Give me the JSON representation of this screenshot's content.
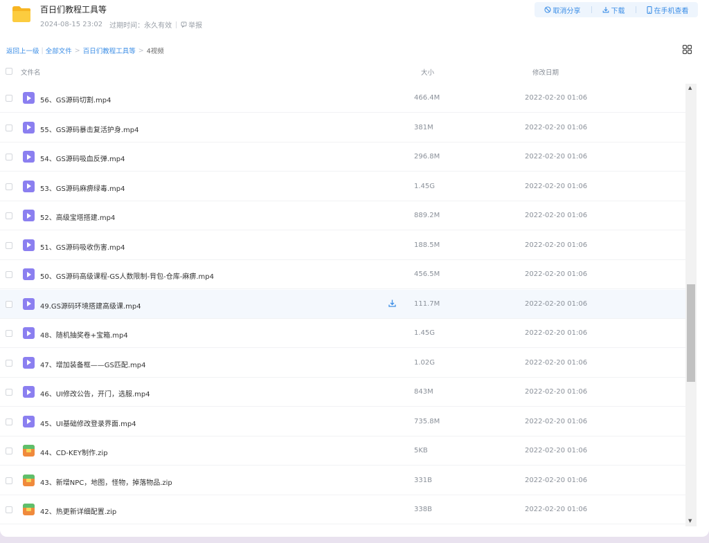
{
  "header": {
    "title": "百日们教程工具等",
    "date": "2024-08-15 23:02",
    "expire_label": "过期时间：永久有效",
    "report_label": "举报"
  },
  "actions": {
    "cancel_share": "取消分享",
    "download": "下载",
    "view_on_phone": "在手机查看"
  },
  "breadcrumb": {
    "back": "返回上一级",
    "all_files": "全部文件",
    "folder": "百日们教程工具等",
    "current": "4视频"
  },
  "columns": {
    "name": "文件名",
    "size": "大小",
    "modified": "修改日期"
  },
  "files": [
    {
      "name": "56、GS源码切割.mp4",
      "size": "466.4M",
      "date": "2022-02-20 01:06",
      "type": "video"
    },
    {
      "name": "55、GS源码暴击复活护身.mp4",
      "size": "381M",
      "date": "2022-02-20 01:06",
      "type": "video"
    },
    {
      "name": "54、GS源码吸血反弹.mp4",
      "size": "296.8M",
      "date": "2022-02-20 01:06",
      "type": "video"
    },
    {
      "name": "53、GS源码麻痹绿毒.mp4",
      "size": "1.45G",
      "date": "2022-02-20 01:06",
      "type": "video"
    },
    {
      "name": "52、高级宝塔搭建.mp4",
      "size": "889.2M",
      "date": "2022-02-20 01:06",
      "type": "video"
    },
    {
      "name": "51、GS源码吸收伤害.mp4",
      "size": "188.5M",
      "date": "2022-02-20 01:06",
      "type": "video"
    },
    {
      "name": "50、GS源码高级课程-GS人数限制-背包-仓库-麻痹.mp4",
      "size": "456.5M",
      "date": "2022-02-20 01:06",
      "type": "video"
    },
    {
      "name": "49.GS源码环境搭建高级课.mp4",
      "size": "111.7M",
      "date": "2022-02-20 01:06",
      "type": "video"
    },
    {
      "name": "48、随机抽奖卷+宝箱.mp4",
      "size": "1.45G",
      "date": "2022-02-20 01:06",
      "type": "video"
    },
    {
      "name": "47、增加装备框——GS匹配.mp4",
      "size": "1.02G",
      "date": "2022-02-20 01:06",
      "type": "video"
    },
    {
      "name": "46、UI修改公告，开门，选服.mp4",
      "size": "843M",
      "date": "2022-02-20 01:06",
      "type": "video"
    },
    {
      "name": "45、UI基础修改登录界面.mp4",
      "size": "735.8M",
      "date": "2022-02-20 01:06",
      "type": "video"
    },
    {
      "name": "44、CD-KEY制作.zip",
      "size": "5KB",
      "date": "2022-02-20 01:06",
      "type": "zip"
    },
    {
      "name": "43、新增NPC，地图，怪物，掉落物品.zip",
      "size": "331B",
      "date": "2022-02-20 01:06",
      "type": "zip"
    },
    {
      "name": "42、热更新详细配置.zip",
      "size": "338B",
      "date": "2022-02-20 01:06",
      "type": "zip"
    }
  ],
  "hovered_row_index": 7,
  "colors": {
    "accent": "#3c8ee6",
    "video_icon": "#8b7ff0",
    "folder_icon": "#fbc934"
  }
}
